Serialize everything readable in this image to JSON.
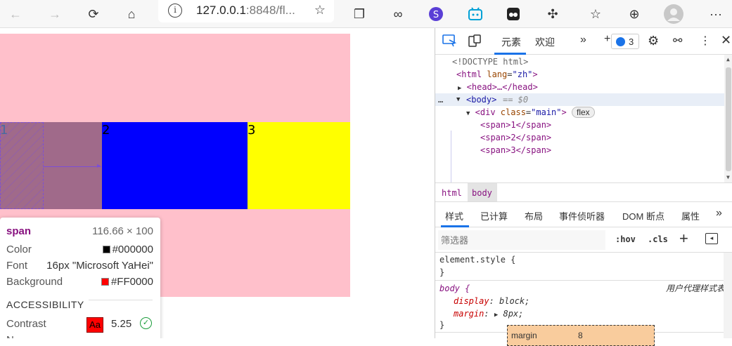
{
  "browser": {
    "address_host": "127.0.0.1",
    "address_rest": ":8848/fl..."
  },
  "page": {
    "colors": {
      "container": "#ffc0cb",
      "item1": "#ff0000",
      "item2": "#0000ff",
      "item3": "#ffff00"
    },
    "items": [
      {
        "label": "1"
      },
      {
        "label": "2"
      },
      {
        "label": "3"
      }
    ]
  },
  "tooltip": {
    "tag": "span",
    "size": "116.66 × 100",
    "color_label": "Color",
    "color_value": "#000000",
    "font_label": "Font",
    "font_value": "16px \"Microsoft YaHei\"",
    "bg_label": "Background",
    "bg_value": "#FF0000",
    "accessibility_heading": "ACCESSIBILITY",
    "contrast_label": "Contrast",
    "contrast_sample": "Aa",
    "contrast_value": "5.25",
    "name_label_partial": "N"
  },
  "devtools": {
    "tabs": {
      "elements": "元素",
      "welcome": "欢迎"
    },
    "issues_count": "3",
    "dom": {
      "doctype": "<!DOCTYPE html>",
      "html_open_tag": "<html",
      "html_attr_name": "lang",
      "html_attr_value": "\"zh\"",
      "head": "<head>…</head>",
      "body_tag": "<body>",
      "body_note": "== $0",
      "div_tag": "<div",
      "div_attr_name": "class",
      "div_attr_value": "\"main\"",
      "flex_badge": "flex",
      "span1": "<span>1</span>",
      "span2": "<span>2</span>",
      "span3": "<span>3</span>"
    },
    "breadcrumbs": [
      "html",
      "body"
    ],
    "styles_tabs": [
      "样式",
      "已计算",
      "布局",
      "事件侦听器",
      "DOM 断点",
      "属性"
    ],
    "filter_placeholder": "筛选器",
    "hov": ":hov",
    "cls": ".cls",
    "rules": {
      "element_style": "element.style {",
      "close": "}",
      "body_selector": "body {",
      "ua_label": "用户代理样式表",
      "display_name": "display",
      "display_value": "block;",
      "margin_name": "margin",
      "margin_value": "8px;"
    },
    "boxmodel": {
      "margin_label": "margin",
      "margin_value": "8"
    }
  }
}
